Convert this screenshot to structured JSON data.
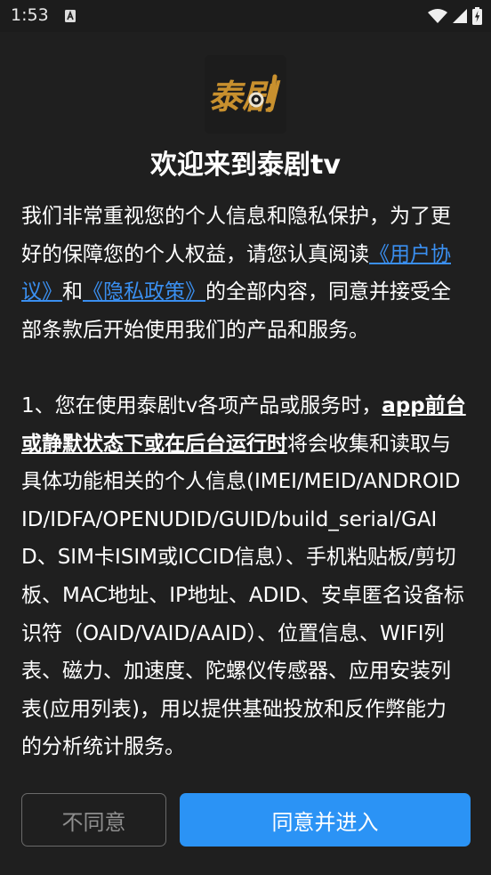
{
  "status_bar": {
    "time": "1:53"
  },
  "dialog": {
    "logo_alt": "泰剧!",
    "title": "欢迎来到泰剧tv",
    "intro": {
      "part1": "我们非常重视您的个人信息和隐私保护，为了更好的保障您的个人权益，请您认真阅读",
      "link_user_agreement": "《用户协议》",
      "and": "和",
      "link_privacy_policy": "《隐私政策》",
      "part2": "的全部内容，同意并接受全部条款后开始使用我们的产品和服务。"
    },
    "clause1": {
      "part1": "1、您在使用泰剧tv各项产品或服务时，",
      "bold": "app前台或静默状态下或在后台运行时",
      "part2": "将会收集和读取与具体功能相关的个人信息(IMEI/MEID/ANDROID ID/IDFA/OPENUDID/GUID/build_serial/GAID、SIM卡ISIM或ICCID信息）、手机粘贴板/剪切板、MAC地址、IP地址、ADID、安卓匿名设备标识符（OAID/VAID/AAID）、位置信息、WIFI列表、磁力、加速度、陀螺仪传感器、应用安装列表(应用列表)，用以提供基础投放和反作弊能力的分析统计服务。"
    },
    "buttons": {
      "disagree": "不同意",
      "agree": "同意并进入"
    }
  },
  "colors": {
    "link": "#3a8ff0",
    "primary_button": "#2b93f5",
    "logo_text": "#c8902e"
  },
  "icons": [
    "status-a-icon",
    "wifi-icon",
    "cell-signal-icon",
    "battery-charging-icon",
    "app-logo-icon"
  ]
}
